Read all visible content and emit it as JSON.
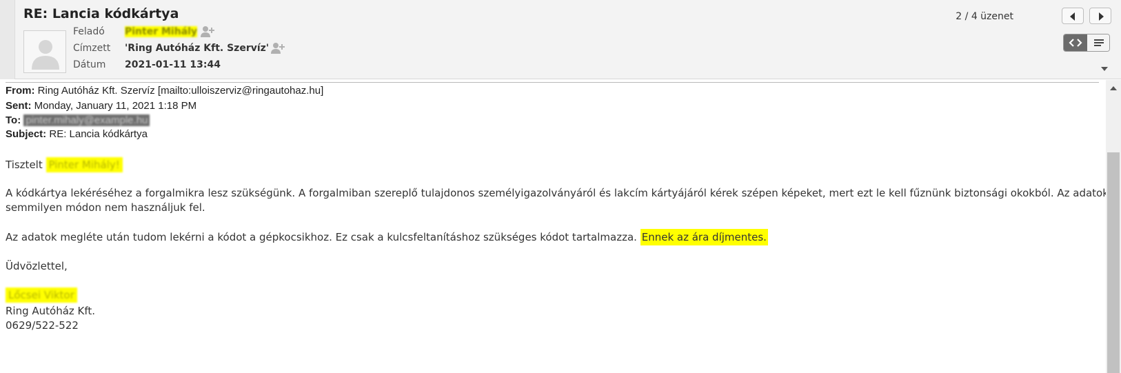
{
  "header": {
    "subject": "RE: Lancia kódkártya",
    "counter": "2 / 4 üzenet",
    "labels": {
      "from": "Feladó",
      "to": "Címzett",
      "date": "Dátum"
    },
    "values": {
      "from_name": "Pinter Mihály",
      "to": "'Ring Autóház Kft. Szervíz'",
      "date": "2021-01-11 13:44"
    },
    "icons": [
      "person-avatar-icon",
      "add-person-icon",
      "chevron-left-icon",
      "chevron-right-icon",
      "source-code-icon",
      "lines-icon",
      "dropdown-arrow-icon"
    ]
  },
  "message": {
    "from_label": "From:",
    "from_value": "Ring Autóház Kft. Szervíz [mailto:ulloiszerviz@ringautohaz.hu]",
    "sent_label": "Sent:",
    "sent_value": "Monday, January 11, 2021 1:18 PM",
    "to_label": "To:",
    "to_value": "pinter.mihaly@example.hu",
    "subject_label": "Subject:",
    "subject_value": "RE: Lancia kódkártya",
    "greeting": "Tisztelt",
    "greeting_name": "Pinter Mihály!",
    "p1_line1": "A kódkártya lekéréséhez a forgalmikra lesz szükségünk. A forgalmiban szereplő tulajdonos személyigazolványáról és lakcím kártyájáról kérek szépen képeket, mert ezt le kell fűznünk biztonsági okokból. Az adatokat",
    "p1_line2": "semmilyen módon nem használjuk fel.",
    "p2_text": "Az adatok megléte után tudom lekérni a kódot a gépkocsikhoz. Ez csak a kulcsfeltanításhoz szükséges kódot tartalmazza.",
    "p2_highlight": "Ennek az ára díjmentes.",
    "closing": "Üdvözlettel,",
    "sig_name": "Lőcsei Viktor",
    "sig_company": "Ring Autóház Kft.",
    "sig_phone": "0629/522-522"
  },
  "colors": {
    "highlight": "#ffff00",
    "header_bg": "#f3f3f3",
    "scroll_thumb": "#c1c1c1"
  }
}
